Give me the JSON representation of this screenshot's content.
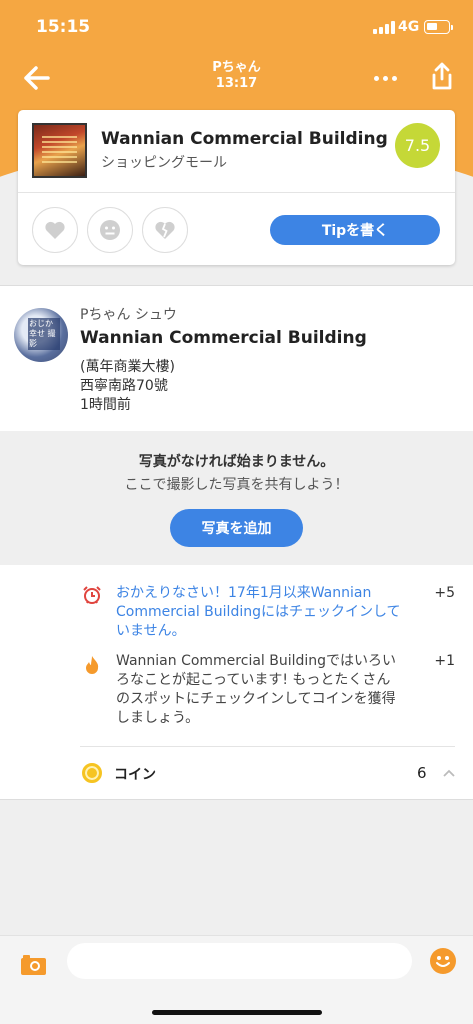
{
  "status": {
    "time": "15:15",
    "network": "4G"
  },
  "nav": {
    "title_line1": "Pちゃん",
    "title_line2": "13:17"
  },
  "venue": {
    "name": "Wannian Commercial Building",
    "category": "ショッピングモール",
    "score": "7.5",
    "tip_button": "Tipを書く"
  },
  "checkin": {
    "user": "Pちゃん シュウ",
    "venue": "Wannian Commercial Building",
    "line1": "(萬年商業大樓)",
    "line2": "西寧南路70號",
    "line3": "1時間前"
  },
  "photo_prompt": {
    "title": "写真がなければ始まりません。",
    "subtitle": "ここで撮影した写真を共有しよう！",
    "button": "写真を追加"
  },
  "rewards": {
    "items": [
      {
        "icon": "alarm-clock-icon",
        "text": "おかえりなさい！17年1月以来Wannian Commercial Buildingにはチェックインしていません。",
        "points": "+5",
        "color": "#3d84e4"
      },
      {
        "icon": "flame-icon",
        "text": "Wannian Commercial Buildingではいろいろなことが起こっています! もっとたくさんのスポットにチェックインしてコインを獲得しましょう。",
        "points": "+1",
        "color": "#444444"
      }
    ],
    "coin_label": "コイン",
    "coin_count": "6"
  },
  "input": {
    "placeholder": ""
  },
  "colors": {
    "header": "#f5a742",
    "accent": "#3d84e4",
    "score": "#c5d837",
    "alarm": "#e0443e",
    "flame": "#f59a2c",
    "coin": "#f6c422"
  }
}
